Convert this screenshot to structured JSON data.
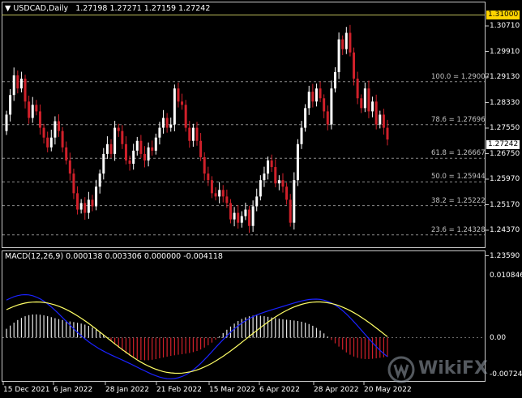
{
  "header": {
    "symbol_timeframe": "USDCAD,Daily",
    "ohlc": "1.27198 1.27271 1.27159 1.27242"
  },
  "macd_header": {
    "label": "MACD(12,26,9) 0.000138 0.003306 0.000000 -0.004118"
  },
  "price_axis": {
    "ticks": [
      "1.30710",
      "1.29910",
      "1.29130",
      "1.28330",
      "1.27550",
      "1.26750",
      "1.25970",
      "1.25170",
      "1.24370",
      "1.23590"
    ],
    "highlight_level": "1.31000",
    "current_price": "1.27242"
  },
  "macd_axis": {
    "ticks": [
      "0.010846",
      "0.00",
      "-0.00724"
    ]
  },
  "fibo_levels": [
    {
      "label": "100.0 = 1.29007",
      "price": 1.29007
    },
    {
      "label": "78.6 = 1.27696",
      "price": 1.27696
    },
    {
      "label": "61.8 = 1.26667",
      "price": 1.26667
    },
    {
      "label": "50.0 = 1.25944",
      "price": 1.25944
    },
    {
      "label": "38.2 = 1.25222",
      "price": 1.25222
    },
    {
      "label": "23.6 = 1.24328",
      "price": 1.24328
    }
  ],
  "time_axis": {
    "labels": [
      "15 Dec 2021",
      "6 Jan 2022",
      "28 Jan 2022",
      "21 Feb 2022",
      "15 Mar 2022",
      "6 Apr 2022",
      "28 Apr 2022",
      "20 May 2022"
    ]
  },
  "watermark": {
    "text": "WikiFX"
  },
  "colors": {
    "bull": "#ffffff",
    "bear": "#d0202a",
    "macd_signal": "#ffff66",
    "macd_main": "#1a22ff",
    "grid": "#8a8a8a"
  }
}
